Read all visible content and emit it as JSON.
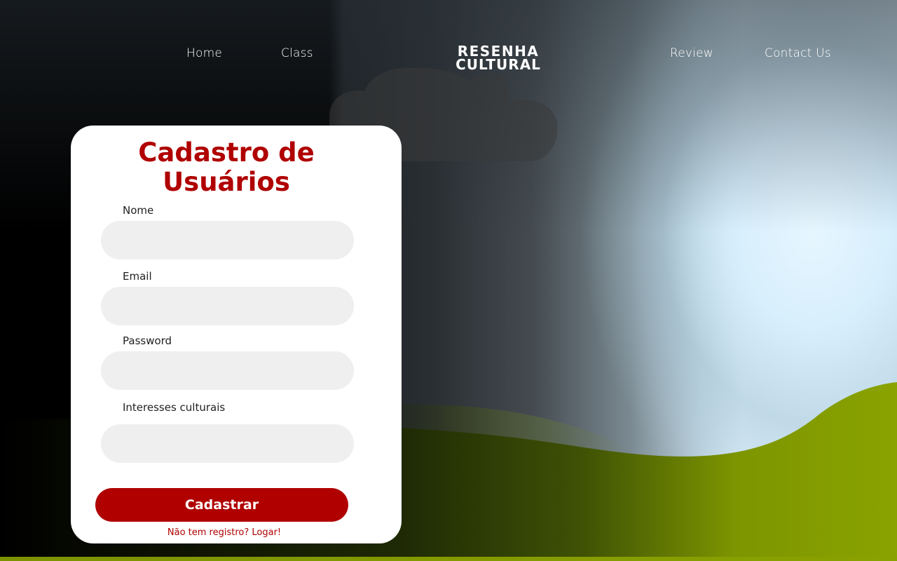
{
  "nav": {
    "items": [
      {
        "label": "Home"
      },
      {
        "label": "Class"
      },
      {
        "label": "Review"
      },
      {
        "label": "Contact Us"
      }
    ]
  },
  "logo": {
    "line1": "RESENHA",
    "line2": "CULTURAL"
  },
  "form": {
    "title_line1": "Cadastro de",
    "title_line2": "Usuários",
    "fields": [
      {
        "label": "Nome",
        "value": "",
        "placeholder": ""
      },
      {
        "label": "Email",
        "value": "",
        "placeholder": ""
      },
      {
        "label": "Password",
        "value": "",
        "placeholder": ""
      },
      {
        "label": "Interesses culturais",
        "value": "",
        "placeholder": ""
      }
    ],
    "submit_label": "Cadastrar",
    "login_link": "Não tem registro? Logar!"
  },
  "colors": {
    "accent": "#b00000",
    "card_background": "#ffffff",
    "input_background": "#efefef",
    "hill_green": "#8aa200"
  },
  "icons": {
    "background_scene": "cloud-and-hills-illustration"
  }
}
